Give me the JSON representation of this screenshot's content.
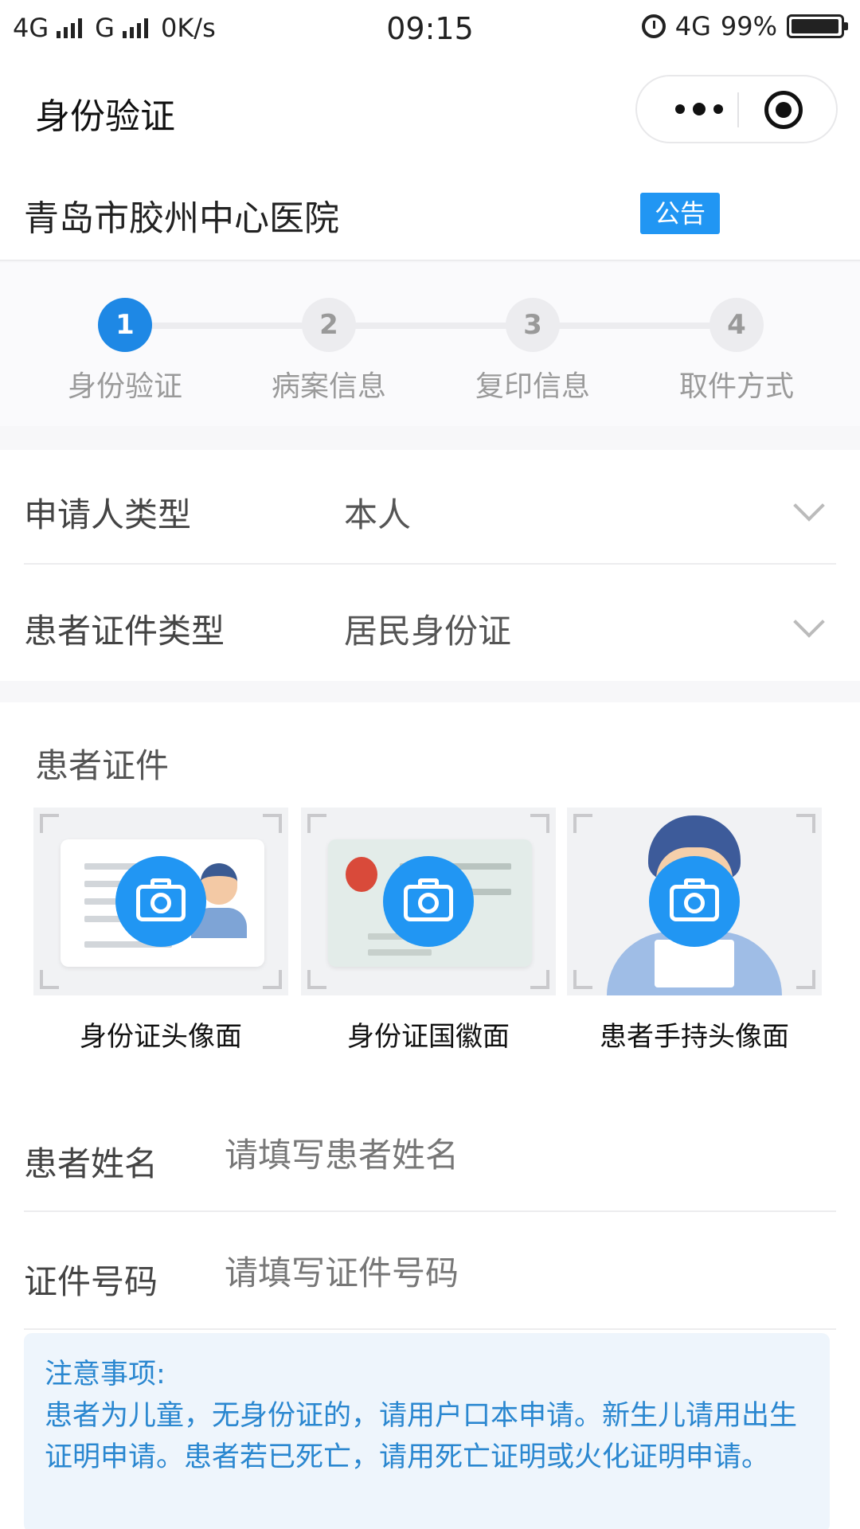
{
  "status_bar": {
    "network1": "4G",
    "network2": "G",
    "speed": "0K/s",
    "time": "09:15",
    "network3": "4G",
    "battery": "99%",
    "battery_level": 0.99
  },
  "nav": {
    "title": "身份验证"
  },
  "hospital": {
    "name": "青岛市胶州中心医院",
    "notice_label": "公告"
  },
  "steps": [
    {
      "num": "1",
      "label": "身份验证",
      "active": true
    },
    {
      "num": "2",
      "label": "病案信息",
      "active": false
    },
    {
      "num": "3",
      "label": "复印信息",
      "active": false
    },
    {
      "num": "4",
      "label": "取件方式",
      "active": false
    }
  ],
  "form": {
    "applicant_type_label": "申请人类型",
    "applicant_type_value": "本人",
    "id_type_label": "患者证件类型",
    "id_type_value": "居民身份证"
  },
  "documents": {
    "title": "患者证件",
    "items": [
      {
        "caption": "身份证头像面"
      },
      {
        "caption": "身份证国徽面"
      },
      {
        "caption": "患者手持头像面"
      }
    ]
  },
  "inputs": {
    "name_label": "患者姓名",
    "name_placeholder": "请填写患者姓名",
    "id_label": "证件号码",
    "id_placeholder": "请填写证件号码"
  },
  "notice": {
    "title": "注意事项:",
    "text": "患者为儿童，无身份证的，请用户口本申请。新生儿请用出生证明申请。患者若已死亡，请用死亡证明或火化证明申请。"
  },
  "colors": {
    "accent": "#2196f3",
    "notice_text": "#2a87d0",
    "notice_bg": "#eef5fc"
  }
}
